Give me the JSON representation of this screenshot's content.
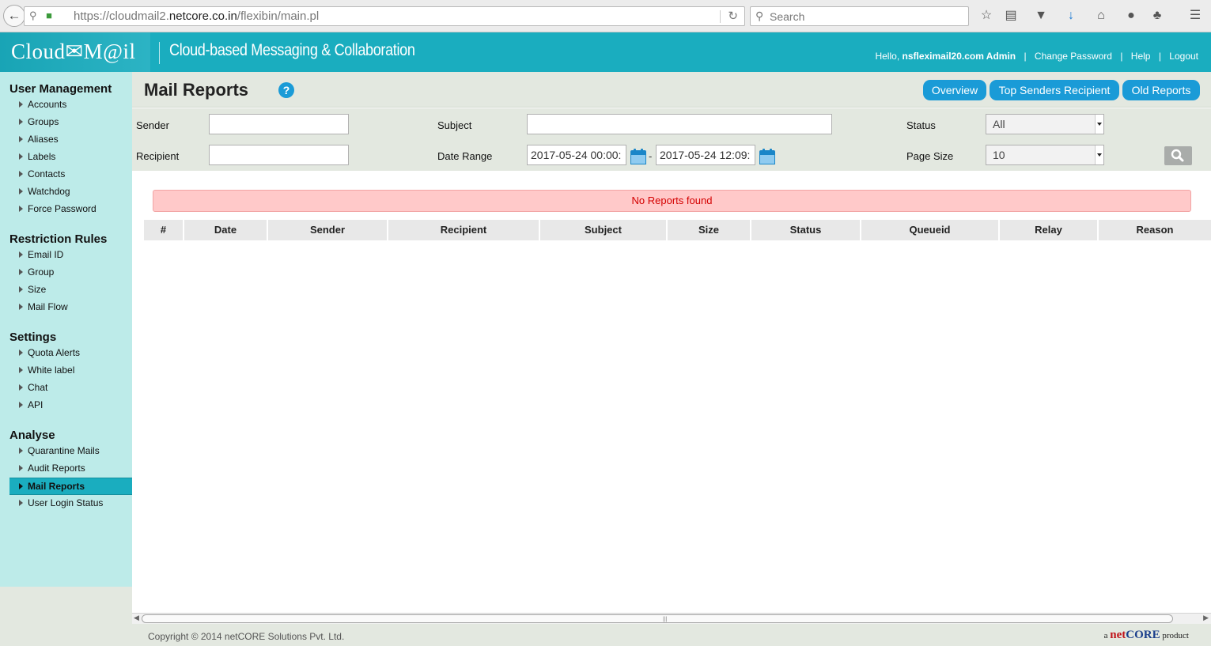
{
  "browser": {
    "url_prefix": "https://cloudmail2.",
    "url_domain": "netcore.co.in",
    "url_path": "/flexibin/main.pl",
    "search_placeholder": "Search"
  },
  "header": {
    "logo": "Cloud✉M@il",
    "tagline": "Cloud-based Messaging & Collaboration",
    "hello": "Hello,",
    "user": "nsfleximail20.com Admin",
    "sep": "|",
    "change_password": "Change Password",
    "help": "Help",
    "logout": "Logout"
  },
  "sidebar": {
    "sections": [
      {
        "title": "User Management",
        "items": [
          "Accounts",
          "Groups",
          "Aliases",
          "Labels",
          "Contacts",
          "Watchdog",
          "Force Password"
        ]
      },
      {
        "title": "Restriction Rules",
        "items": [
          "Email ID",
          "Group",
          "Size",
          "Mail Flow"
        ]
      },
      {
        "title": "Settings",
        "items": [
          "Quota Alerts",
          "White label",
          "Chat",
          "API"
        ]
      },
      {
        "title": "Analyse",
        "items": [
          "Quarantine Mails",
          "Audit Reports",
          "Mail Reports",
          "User Login Status"
        ]
      }
    ],
    "active_item": "Mail Reports"
  },
  "page": {
    "title": "Mail Reports",
    "help_glyph": "?",
    "tabs": [
      "Overview",
      "Top Senders Recipient",
      "Old Reports"
    ]
  },
  "filters": {
    "sender_label": "Sender",
    "sender_value": "",
    "recipient_label": "Recipient",
    "recipient_value": "",
    "subject_label": "Subject",
    "subject_value": "",
    "date_range_label": "Date Range",
    "date_from": "2017-05-24 00:00:",
    "date_separator": "-",
    "date_to": "2017-05-24 12:09:",
    "status_label": "Status",
    "status_value": "All",
    "page_size_label": "Page Size",
    "page_size_value": "10"
  },
  "results": {
    "message": "No Reports found",
    "columns": [
      "#",
      "Date",
      "Sender",
      "Recipient",
      "Subject",
      "Size",
      "Status",
      "Queueid",
      "Relay",
      "Reason"
    ]
  },
  "footer": {
    "copyright": "Copyright © 2014 netCORE Solutions Pvt. Ltd.",
    "brand_prefix": "a ",
    "brand_net": "net",
    "brand_core": "CORE",
    "brand_suffix": " product"
  },
  "colors": {
    "header_teal": "#1aadbf",
    "sidebar_bg": "#bdebe9",
    "button_blue": "#1a9bd7",
    "alert_bg": "#ffc9c9",
    "alert_text": "#d40000"
  }
}
